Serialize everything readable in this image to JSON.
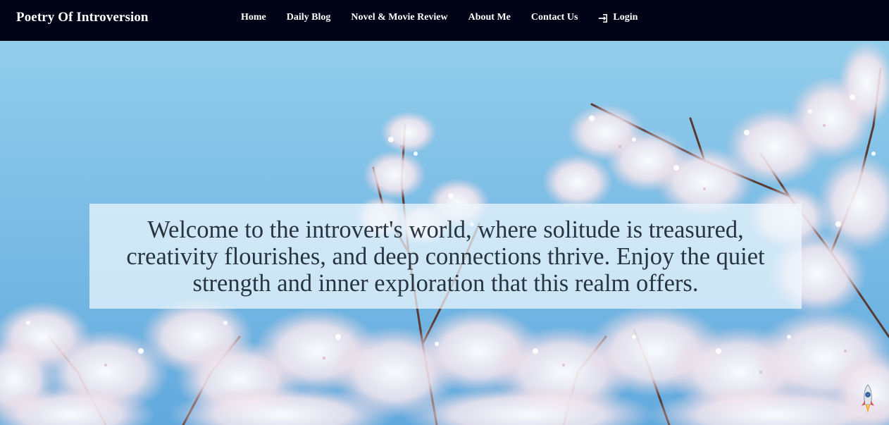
{
  "brand": {
    "title": "Poetry Of Introversion"
  },
  "nav": {
    "items": [
      {
        "label": "Home"
      },
      {
        "label": "Daily Blog"
      },
      {
        "label": "Novel & Movie Review"
      },
      {
        "label": "About Me"
      },
      {
        "label": "Contact Us"
      }
    ],
    "login": {
      "label": "Login",
      "icon": "sign-in-icon"
    }
  },
  "hero": {
    "welcome_text": "Welcome to the introvert's world, where solitude is treasured, creativity flourishes, and deep connections thrive. Enjoy the quiet strength and inner exploration that this realm offers.",
    "background": "cherry-blossom-sky-image"
  },
  "scroll_top": {
    "icon": "rocket-icon"
  },
  "colors": {
    "navbar_bg": "#000416",
    "nav_text": "#ffffff",
    "sky": "#7ec2e6",
    "welcome_text": "#283440",
    "welcome_box": "rgba(240,248,253,0.72)"
  }
}
